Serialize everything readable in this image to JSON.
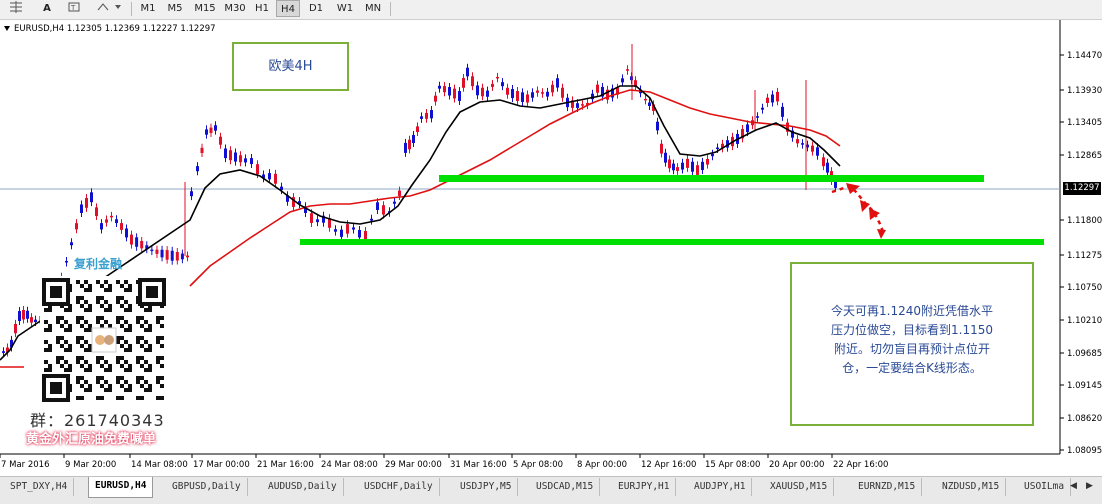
{
  "toolbar": {
    "timeframes": [
      "M1",
      "M5",
      "M15",
      "M30",
      "H1",
      "H4",
      "D1",
      "W1",
      "MN"
    ],
    "active_timeframe": "H4"
  },
  "chart": {
    "header": "EURUSD,H4  1.12305 1.12369 1.12227 1.12297",
    "annotation_box": "欧美4H",
    "current_price_label": "1.12297",
    "price_axis": [
      "1.14470",
      "1.13930",
      "1.13405",
      "1.12865",
      "1.12297",
      "1.11800",
      "1.11275",
      "1.10750",
      "1.10210",
      "1.09685",
      "1.09145",
      "1.08620",
      "1.08095"
    ],
    "time_axis": [
      "7 Mar 2016",
      "9 Mar 20:00",
      "14 Mar 08:00",
      "17 Mar 00:00",
      "21 Mar 16:00",
      "24 Mar 08:00",
      "29 Mar 00:00",
      "31 Mar 16:00",
      "5 Apr 08:00",
      "8 Apr 00:00",
      "12 Apr 16:00",
      "15 Apr 08:00",
      "20 Apr 00:00",
      "22 Apr 16:00"
    ],
    "comment_lines": [
      "今天可再1.1240附近凭借水平",
      "压力位做空，目标看到1.1150",
      "附近。切勿盲目再预计点位开",
      "仓，一定要结合K线形态。"
    ],
    "watermark_brand": "复利金融",
    "watermark_group": "群：261740343",
    "watermark_promo": "黄金外汇原油免费喊单",
    "colors": {
      "bull": "#1010d0",
      "bear": "#e0102a",
      "ma_fast": "#000000",
      "ma_slow": "#e01010",
      "support": "#00e000",
      "frame": "#7ab03a"
    }
  },
  "tabs": [
    "SPT_DXY,H4",
    "EURUSD,H4",
    "GBPUSD,Daily",
    "AUDUSD,Daily",
    "USDCHF,Daily",
    "USDJPY,M5",
    "USDCAD,M15",
    "EURJPY,H1",
    "AUDJPY,H1",
    "XAUUSD,M15",
    "EURNZD,M15",
    "NZDUSD,M15",
    "USOILma"
  ],
  "active_tab": "EURUSD,H4"
}
